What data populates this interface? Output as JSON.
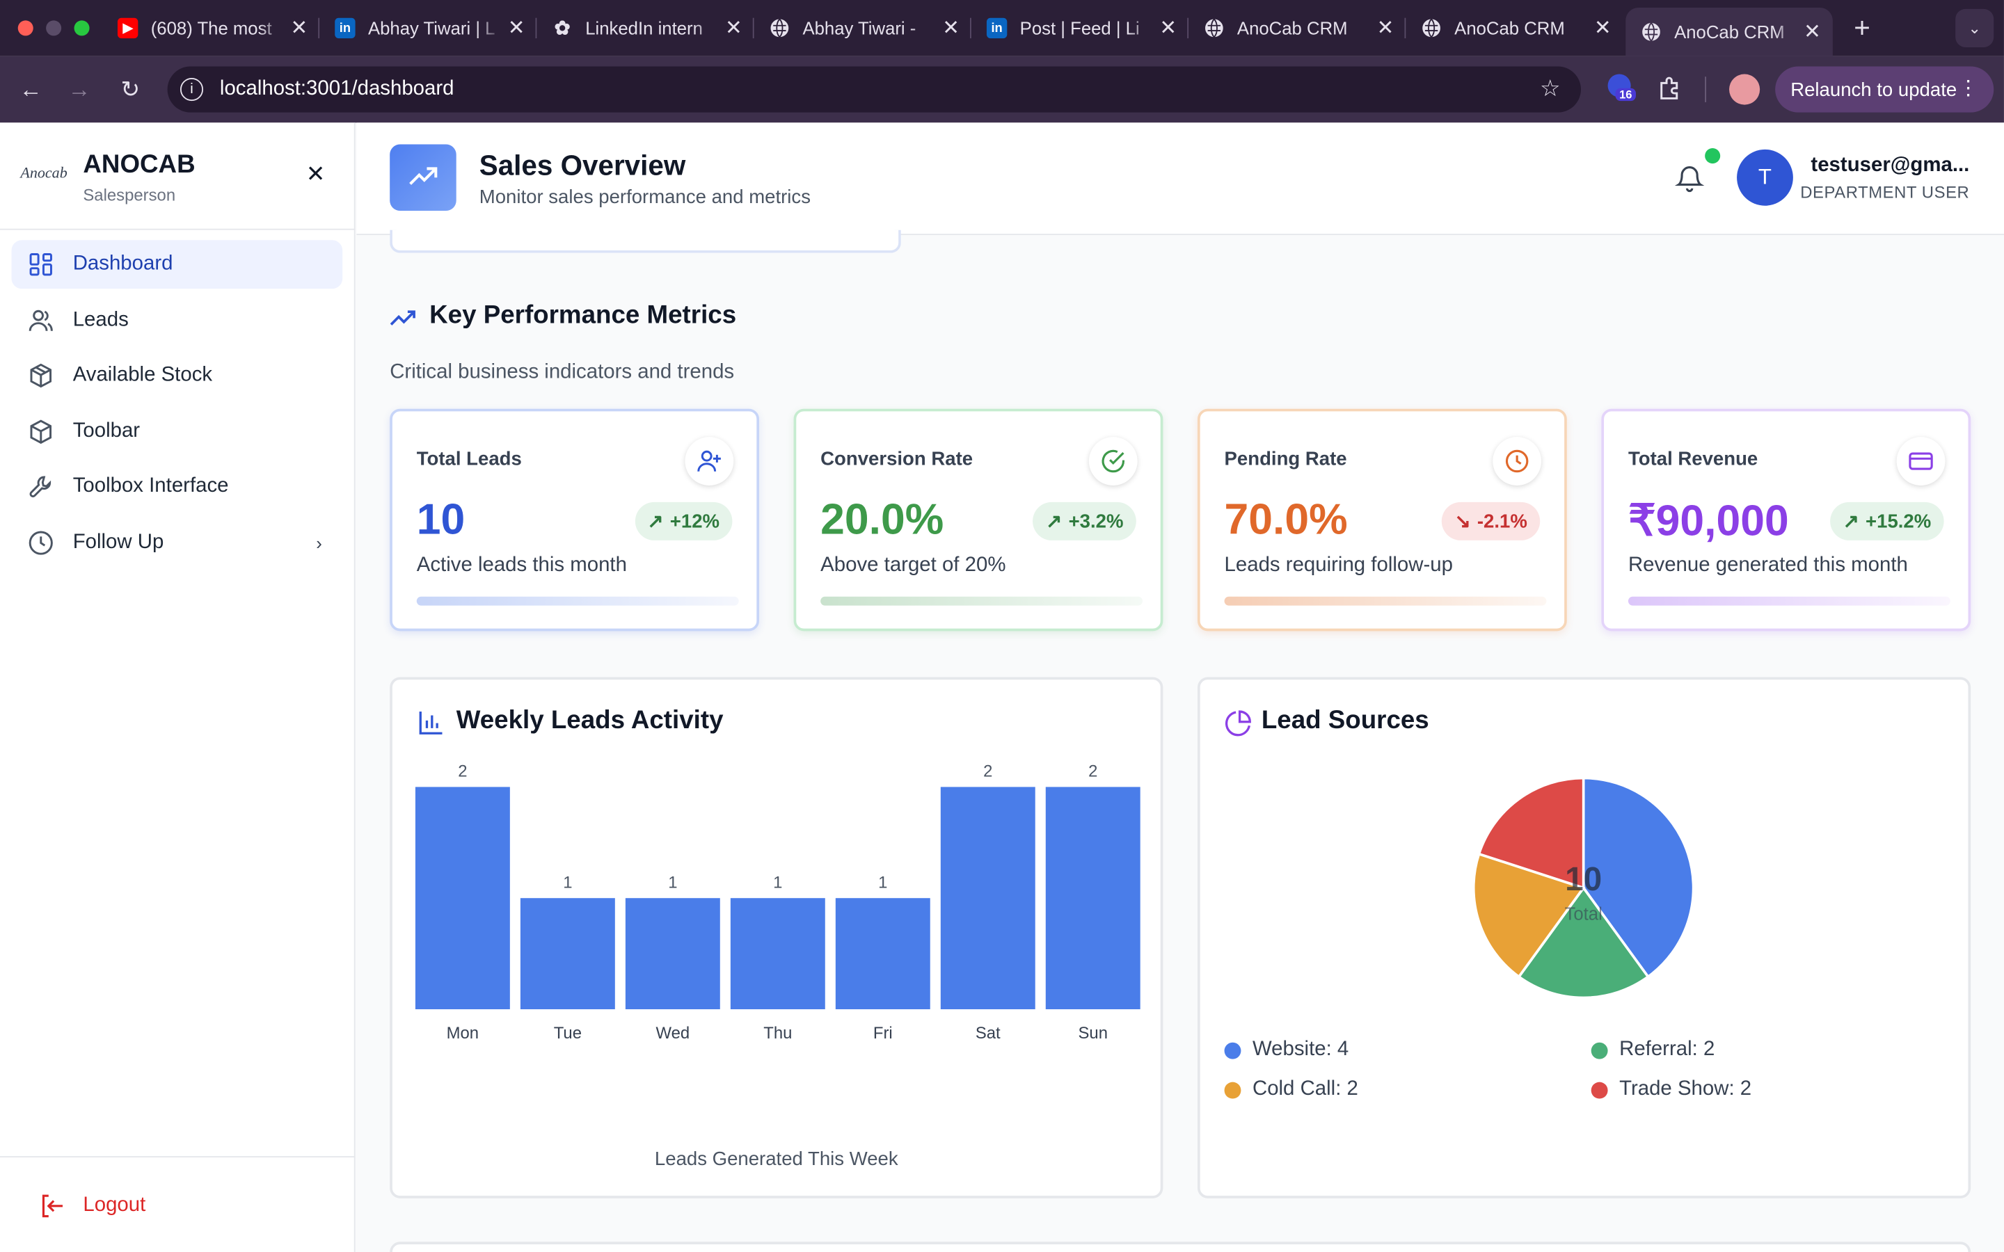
{
  "browser": {
    "tabs": [
      {
        "title": "(608) The most",
        "icon": "youtube-icon"
      },
      {
        "title": "Abhay Tiwari | L",
        "icon": "linkedin-icon"
      },
      {
        "title": "LinkedIn intern",
        "icon": "chatgpt-icon"
      },
      {
        "title": "Abhay Tiwari -",
        "icon": "globe-icon"
      },
      {
        "title": "Post | Feed | Li",
        "icon": "linkedin-icon"
      },
      {
        "title": "AnoCab CRM",
        "icon": "globe-icon"
      },
      {
        "title": "AnoCab CRM",
        "icon": "globe-icon"
      },
      {
        "title": "AnoCab CRM",
        "icon": "globe-icon"
      }
    ],
    "url": "localhost:3001/dashboard",
    "extension_badge": "16",
    "relaunch_label": "Relaunch to update"
  },
  "sidebar": {
    "brand": "ANOCAB",
    "logo_text": "Anocab",
    "role": "Salesperson",
    "items": [
      {
        "label": "Dashboard",
        "icon": "dashboard-grid-icon",
        "active": true
      },
      {
        "label": "Leads",
        "icon": "users-icon"
      },
      {
        "label": "Available Stock",
        "icon": "package-icon"
      },
      {
        "label": "Toolbar",
        "icon": "box-icon"
      },
      {
        "label": "Toolbox Interface",
        "icon": "wrench-icon"
      },
      {
        "label": "Follow Up",
        "icon": "clock-icon"
      }
    ],
    "logout": "Logout"
  },
  "header": {
    "title": "Sales Overview",
    "subtitle": "Monitor sales performance and metrics",
    "user_initial": "T",
    "user_email": "testuser@gma...",
    "user_role": "DEPARTMENT USER"
  },
  "kpi_section": {
    "title": "Key Performance Metrics",
    "subtitle": "Critical business indicators and trends"
  },
  "kpis": [
    {
      "title": "Total Leads",
      "value": "10",
      "change": "+12%",
      "desc": "Active leads this month",
      "color": "#2f55d4",
      "trend": "up"
    },
    {
      "title": "Conversion Rate",
      "value": "20.0%",
      "change": "+3.2%",
      "desc": "Above target of 20%",
      "color": "#3e9a4a",
      "trend": "up"
    },
    {
      "title": "Pending Rate",
      "value": "70.0%",
      "change": "-2.1%",
      "desc": "Leads requiring follow-up",
      "color": "#e0682a",
      "trend": "down"
    },
    {
      "title": "Total Revenue",
      "value": "₹90,000",
      "change": "+15.2%",
      "desc": "Revenue generated this month",
      "color": "#8b3fe6",
      "trend": "up"
    }
  ],
  "weekly_chart": {
    "title": "Weekly Leads Activity",
    "caption": "Leads Generated This Week"
  },
  "lead_sources": {
    "title": "Lead Sources",
    "center_value": "10",
    "center_label": "Total",
    "legend": [
      {
        "label": "Website: 4",
        "color": "#4a7de9"
      },
      {
        "label": "Referral: 2",
        "color": "#4aae78"
      },
      {
        "label": "Cold Call: 2",
        "color": "#e8a136"
      },
      {
        "label": "Trade Show: 2",
        "color": "#dd4a47"
      }
    ]
  },
  "chart_data": [
    {
      "type": "bar",
      "title": "Weekly Leads Activity",
      "categories": [
        "Mon",
        "Tue",
        "Wed",
        "Thu",
        "Fri",
        "Sat",
        "Sun"
      ],
      "values": [
        2,
        1,
        1,
        1,
        1,
        2,
        2
      ],
      "xlabel": "Leads Generated This Week",
      "ylim": [
        0,
        2
      ],
      "color": "#4a7de9"
    },
    {
      "type": "pie",
      "title": "Lead Sources",
      "categories": [
        "Website",
        "Referral",
        "Cold Call",
        "Trade Show"
      ],
      "values": [
        4,
        2,
        2,
        2
      ],
      "colors": [
        "#4a7de9",
        "#4aae78",
        "#e8a136",
        "#dd4a47"
      ]
    }
  ]
}
